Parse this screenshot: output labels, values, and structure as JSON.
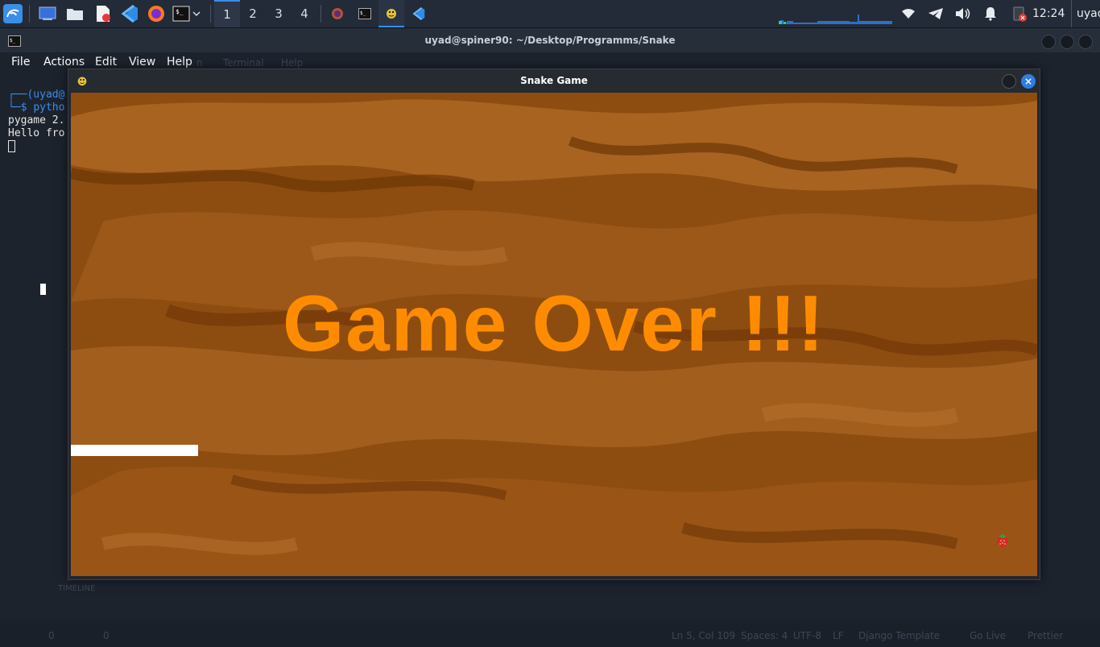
{
  "panel": {
    "workspaces": [
      "1",
      "2",
      "3",
      "4"
    ],
    "active_workspace": "1",
    "clock": "12:24",
    "user": "uyad",
    "icons": [
      "kali-menu-icon",
      "desktop-icon",
      "file-manager-icon",
      "text-editor-icon",
      "vscode-icon",
      "firefox-icon",
      "terminal-icon",
      "chevron-down-icon"
    ],
    "tasks": [
      "firefox-task-icon",
      "terminal-task-icon",
      "pygame-task-icon",
      "vscode-task-icon"
    ],
    "tray": [
      "wifi-icon",
      "telegram-icon",
      "volume-icon",
      "bell-icon",
      "battery-icon"
    ]
  },
  "terminal": {
    "title": "uyad@spiner90: ~/Desktop/Programms/Snake",
    "menu": [
      "File",
      "Actions",
      "Edit",
      "View",
      "Help"
    ],
    "lines": {
      "prompt_top": "┌──(uyad@",
      "prompt_cmd_prefix": "└─$ ",
      "command": "pytho",
      "line2": "pygame 2.",
      "line3": "Hello fro"
    }
  },
  "game_window": {
    "title": "Snake Game",
    "message": "Game Over !!!",
    "colors": {
      "message": "#ff8c00",
      "snake": "#ffffff",
      "background": "#8b4a0d"
    }
  },
  "background_app": {
    "menu_ghost": [
      "n",
      "Terminal",
      "Help"
    ],
    "timeline": "TIMELINE",
    "status": [
      "Ln 5, Col 109",
      "Spaces: 4",
      "UTF-8",
      "LF",
      "Django Template",
      "Go Live",
      "Prettier"
    ],
    "errors": "0",
    "warnings": "0"
  }
}
